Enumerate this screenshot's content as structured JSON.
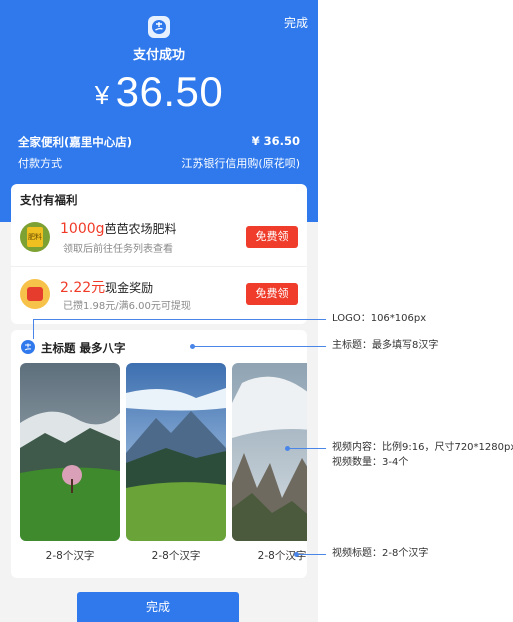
{
  "header": {
    "done_label": "完成",
    "logo_icon": "alipay-logo-icon",
    "status": "支付成功",
    "currency": "¥",
    "amount": "36.50",
    "merchant_name": "全家便利(嘉里中心店)",
    "merchant_amount": "¥ 36.50",
    "pay_method_label": "付款方式",
    "pay_method_value": "江苏银行信用购(原花呗)"
  },
  "benefits": {
    "title": "支付有福利",
    "items": [
      {
        "icon": "fertilizer-icon",
        "icon_text": "肥料",
        "highlight": "1000g",
        "name": "芭芭农场肥料",
        "sub": "领取后前往任务列表查看",
        "button": "免费领"
      },
      {
        "icon": "red-envelope-icon",
        "highlight": "2.22元",
        "name": "现金奖励",
        "sub": "已攒1.98元/满6.00元可提现",
        "button": "免费领"
      }
    ]
  },
  "video": {
    "logo_icon": "brand-logo-icon",
    "title": "主标题 最多八字",
    "thumbs": [
      {
        "icon": "mountain-valley-thumbnail",
        "caption": "2-8个汉字"
      },
      {
        "icon": "mountain-lake-thumbnail",
        "caption": "2-8个汉字"
      },
      {
        "icon": "rock-peaks-thumbnail",
        "caption": "2-8个汉字"
      }
    ]
  },
  "bottom_button": "完成",
  "annotations": {
    "logo": "LOGO：106*106px",
    "main_title": "主标题：最多填写8汉字",
    "video_content_1": "视频内容：比例9:16，尺寸720*1280px",
    "video_content_2": "视频数量：3-4个",
    "video_title": "视频标题：2-8个汉字"
  },
  "colors": {
    "primary": "#2f79ec",
    "red": "#ef3c2b",
    "annotation": "#4a86e8"
  }
}
